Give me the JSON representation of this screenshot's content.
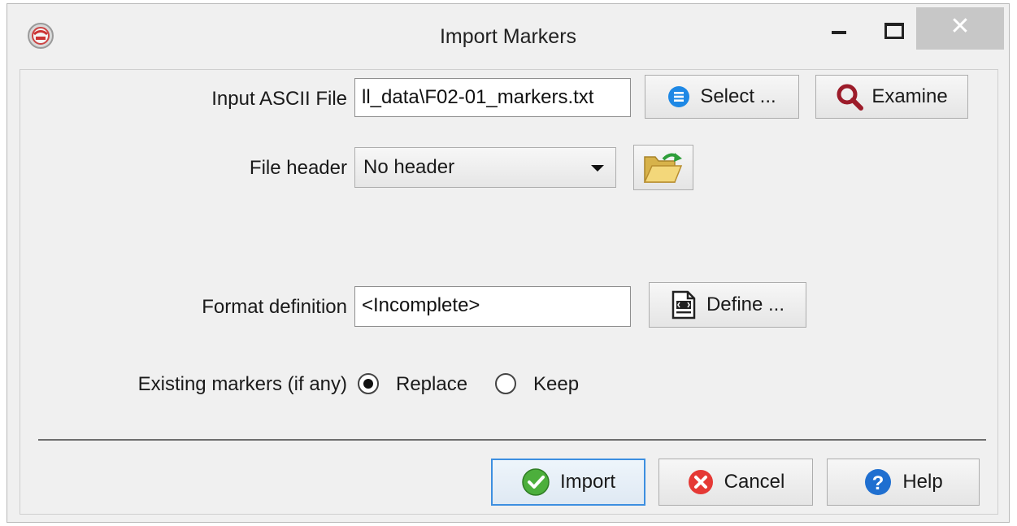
{
  "window": {
    "title": "Import Markers",
    "close_glyph": "✕"
  },
  "form": {
    "input_file": {
      "label": "Input ASCII File",
      "value": "ll_data\\F02-01_markers.txt",
      "select_button": "Select ...",
      "examine_button": "Examine"
    },
    "file_header": {
      "label": "File header",
      "selected": "No header"
    },
    "format_definition": {
      "label": "Format definition",
      "value": "<Incomplete>",
      "define_button": "Define ..."
    },
    "existing_markers": {
      "label": "Existing markers (if any)",
      "options": [
        {
          "label": "Replace",
          "checked": true
        },
        {
          "label": "Keep",
          "checked": false
        }
      ]
    }
  },
  "footer": {
    "import_label": "Import",
    "cancel_label": "Cancel",
    "help_label": "Help"
  },
  "colors": {
    "accent_border": "#3d8fe0",
    "import_icon": "#4caf3c",
    "cancel_icon": "#e53935",
    "help_icon": "#1f6fd0",
    "select_icon": "#1e88e5",
    "examine_icon": "#9c1c2a"
  },
  "icons": {
    "app": "app-logo-icon",
    "select": "list-icon",
    "examine": "magnifier-icon",
    "open_folder": "open-folder-icon",
    "define": "document-code-icon",
    "import": "checkmark-icon",
    "cancel": "close-circle-icon",
    "help": "question-icon"
  }
}
